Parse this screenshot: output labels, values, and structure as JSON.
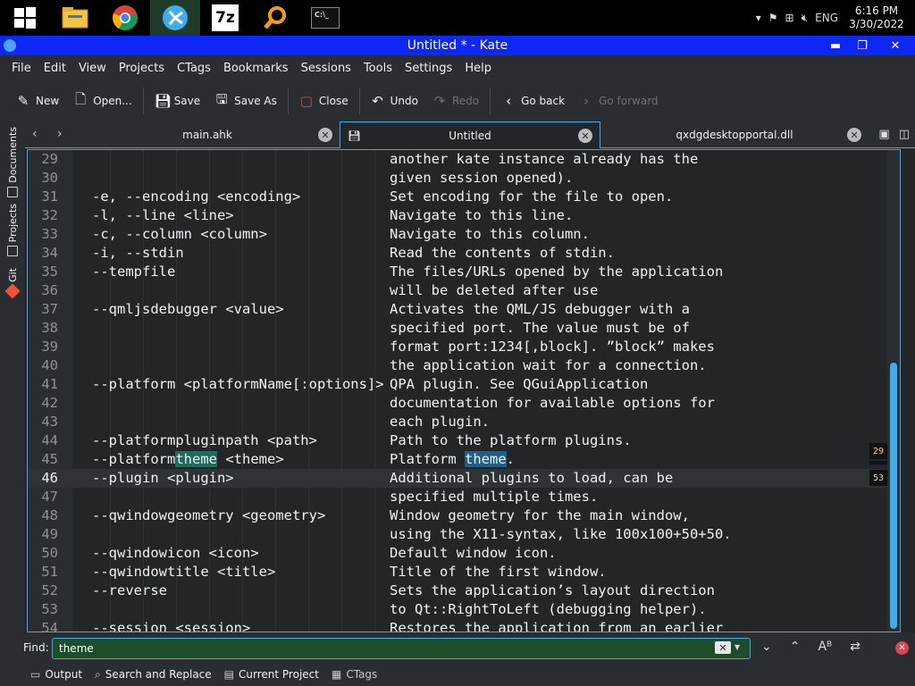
{
  "taskbar": {
    "apps": [
      {
        "name": "start",
        "icon": "windows-logo-icon",
        "active": false
      },
      {
        "name": "file-explorer",
        "icon": "folder-icon",
        "active": false
      },
      {
        "name": "chrome",
        "icon": "chrome-icon",
        "active": false
      },
      {
        "name": "kate",
        "icon": "kate-icon",
        "active": true
      },
      {
        "name": "7zip",
        "icon": "7z-icon",
        "glyph": "7z",
        "active": false
      },
      {
        "name": "search",
        "icon": "magnifier-icon",
        "active": false
      },
      {
        "name": "terminal",
        "icon": "terminal-icon",
        "glyph": "C:\\_",
        "active": false
      }
    ],
    "tray": {
      "language": "ENG",
      "time": "6:16 PM",
      "date": "3/30/2022"
    }
  },
  "window": {
    "title": "Untitled * - Kate"
  },
  "menu": [
    "File",
    "Edit",
    "View",
    "Projects",
    "CTags",
    "Bookmarks",
    "Sessions",
    "Tools",
    "Settings",
    "Help"
  ],
  "toolbar": {
    "new": "New",
    "open": "Open...",
    "save": "Save",
    "save_as": "Save As",
    "close": "Close",
    "undo": "Undo",
    "redo": "Redo",
    "go_back": "Go back",
    "go_forward": "Go forward"
  },
  "sidebar": {
    "documents": "Documents",
    "projects": "Projects",
    "git": "Git"
  },
  "tabs": [
    {
      "label": "main.ahk",
      "active": false
    },
    {
      "label": "Untitled",
      "active": true
    },
    {
      "label": "qxdgdesktopportal.dll",
      "active": false
    }
  ],
  "editor": {
    "current_line": 46,
    "search_term": "theme",
    "lines": [
      {
        "n": "29",
        "a": "",
        "b": "another kate instance already has the"
      },
      {
        "n": "30",
        "a": "",
        "b": "given session opened)."
      },
      {
        "n": "31",
        "a": "-e, --encoding <encoding>",
        "b": "Set encoding for the file to open."
      },
      {
        "n": "32",
        "a": "-l, --line <line>",
        "b": "Navigate to this line."
      },
      {
        "n": "33",
        "a": "-c, --column <column>",
        "b": "Navigate to this column."
      },
      {
        "n": "34",
        "a": "-i, --stdin",
        "b": "Read the contents of stdin."
      },
      {
        "n": "35",
        "a": "--tempfile",
        "b": "The files/URLs opened by the application"
      },
      {
        "n": "36",
        "a": "",
        "b": "will be deleted after use"
      },
      {
        "n": "37",
        "a": "--qmljsdebugger <value>",
        "b": "Activates the QML/JS debugger with a"
      },
      {
        "n": "38",
        "a": "",
        "b": "specified port. The value must be of"
      },
      {
        "n": "39",
        "a": "",
        "b": "format port:1234[,block]. ”block” makes"
      },
      {
        "n": "40",
        "a": "",
        "b": "the application wait for a connection."
      },
      {
        "n": "41",
        "a": "--platform <platformName[:options]>",
        "b": "QPA plugin. See QGuiApplication"
      },
      {
        "n": "42",
        "a": "",
        "b": "documentation for available options for"
      },
      {
        "n": "43",
        "a": "",
        "b": "each plugin."
      },
      {
        "n": "44",
        "a": "--platformpluginpath <path>",
        "b": "Path to the platform plugins."
      },
      {
        "n": "45",
        "a": "--platformtheme <theme>",
        "b": "Platform theme."
      },
      {
        "n": "46",
        "a": "--plugin <plugin>",
        "b": "Additional plugins to load, can be"
      },
      {
        "n": "47",
        "a": "",
        "b": "specified multiple times."
      },
      {
        "n": "48",
        "a": "--qwindowgeometry <geometry>",
        "b": "Window geometry for the main window,"
      },
      {
        "n": "49",
        "a": "",
        "b": "using the X11-syntax, like 100x100+50+50."
      },
      {
        "n": "50",
        "a": "--qwindowicon <icon>",
        "b": "Default window icon."
      },
      {
        "n": "51",
        "a": "--qwindowtitle <title>",
        "b": "Title of the first window."
      },
      {
        "n": "52",
        "a": "--reverse",
        "b": "Sets the application’s layout direction"
      },
      {
        "n": "53",
        "a": "",
        "b": "to Qt::RightToLeft (debugging helper)."
      },
      {
        "n": "54",
        "a": "--session <session>",
        "b": "Restores the application from an earlier"
      }
    ],
    "badges": {
      "top": "29",
      "bottom": "53"
    }
  },
  "find": {
    "label": "Find:",
    "value": "theme"
  },
  "bottom": {
    "output": "Output",
    "search_replace": "Search and Replace",
    "current_project": "Current Project",
    "ctags": "CTags"
  },
  "colors": {
    "accent": "#3daee9",
    "titlebar": "#0c27f6",
    "match_current": "#1e6a5c",
    "match_other": "#1d5f86",
    "find_bg": "#1e4d2b"
  }
}
